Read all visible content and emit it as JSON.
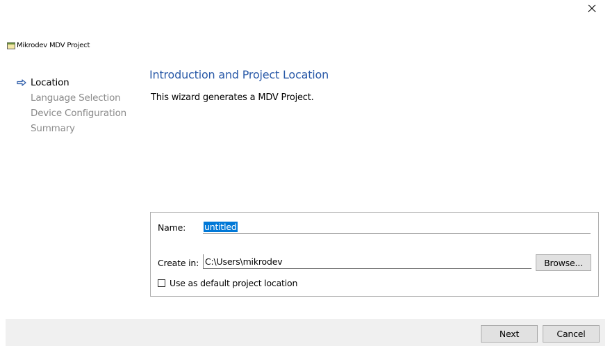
{
  "window": {
    "title": "Mikrodev MDV Project",
    "close_icon": "close-icon",
    "app_icon": "window-app-icon"
  },
  "steps": [
    {
      "label": "Location",
      "active": true
    },
    {
      "label": "Language Selection",
      "active": false
    },
    {
      "label": "Device Configuration",
      "active": false
    },
    {
      "label": "Summary",
      "active": false
    }
  ],
  "main": {
    "title": "Introduction and Project Location",
    "description": "This wizard generates a MDV Project."
  },
  "form": {
    "name_label": "Name:",
    "name_value": "untitled",
    "create_in_label": "Create in:",
    "create_in_value": "C:\\Users\\mikrodev",
    "browse_label": "Browse...",
    "default_location_label": "Use as default project location",
    "default_location_checked": false
  },
  "footer": {
    "next_label": "Next",
    "cancel_label": "Cancel"
  },
  "colors": {
    "title_blue": "#2a5aa8",
    "selection_blue": "#0078d7",
    "inactive_step": "#8a8a8a",
    "footer_bg": "#f0f0f0",
    "button_bg": "#e1e1e1"
  }
}
